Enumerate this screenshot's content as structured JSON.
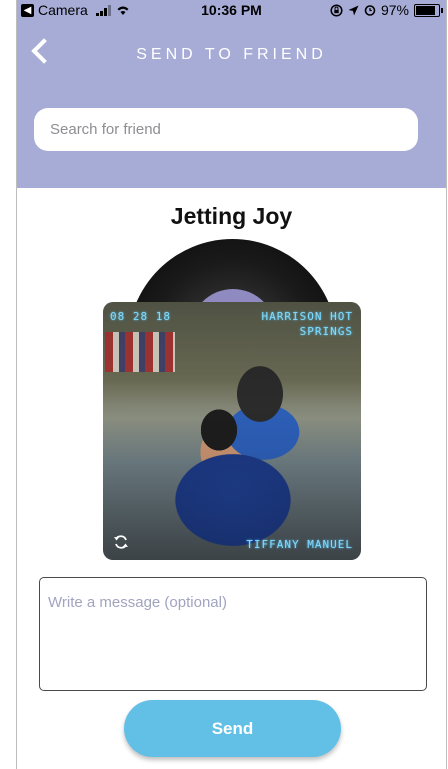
{
  "status_bar": {
    "back_app_label": "Camera",
    "time": "10:36 PM",
    "battery_percent": "97%",
    "battery_level": 0.97,
    "icons": [
      "back-app-icon",
      "signal-icon",
      "wifi-icon",
      "lock-rotation-icon",
      "location-icon",
      "alarm-icon",
      "battery-icon"
    ]
  },
  "header": {
    "title": "SEND TO FRIEND",
    "back_icon": "chevron-left-icon",
    "search": {
      "placeholder": "Search for friend",
      "value": ""
    }
  },
  "song": {
    "title": "Jetting Joy"
  },
  "photo": {
    "date_stamp": "08 28 18",
    "location_stamp_line1": "HARRISON HOT",
    "location_stamp_line2": "SPRINGS",
    "names_stamp": "TIFFANY MANUEL",
    "rotate_icon": "refresh-icon"
  },
  "message": {
    "placeholder": "Write a message (optional)",
    "value": ""
  },
  "actions": {
    "send_label": "Send"
  },
  "colors": {
    "header_bg": "#a7acd7",
    "record_label": "#8f8bc0",
    "send_button": "#62bfe5",
    "lcd_text": "#7fdcff"
  }
}
